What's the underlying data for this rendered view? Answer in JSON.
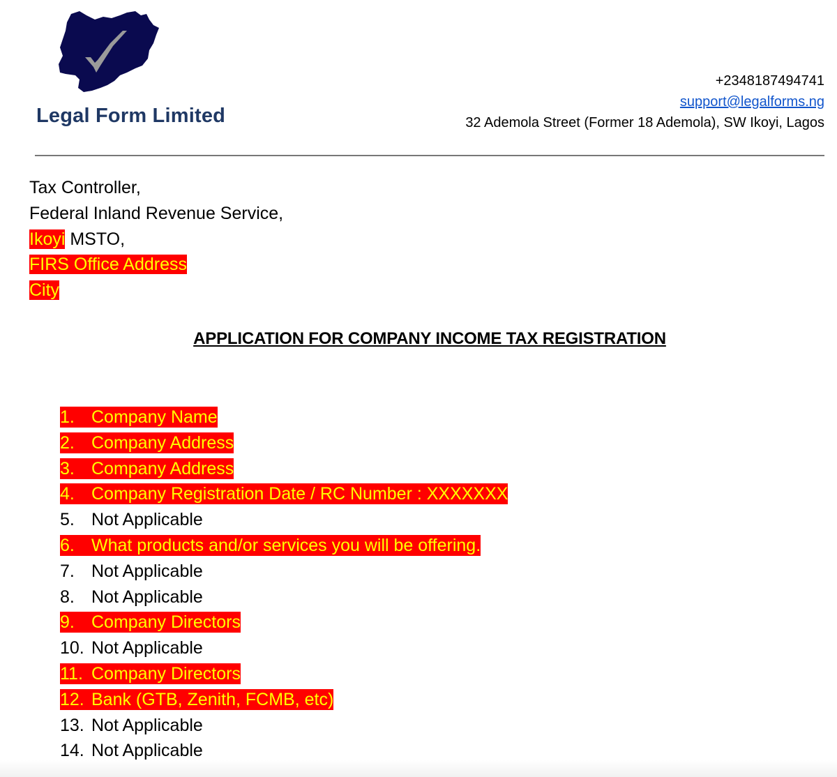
{
  "letterhead": {
    "logo_icon": "nigeria-map-checkmark-logo",
    "company_name": "Legal Form Limited",
    "phone": "+2348187494741",
    "email": "support@legalforms.ng",
    "address": "32 Ademola Street (Former 18 Ademola), SW Ikoyi, Lagos"
  },
  "recipient": {
    "line1": "Tax Controller,",
    "line2": "Federal Inland Revenue Service,",
    "line3_highlight": "Ikoyi",
    "line3_rest": " MSTO,",
    "line4": "FIRS Office Address",
    "line5": "City"
  },
  "title": "APPLICATION FOR COMPANY INCOME TAX REGISTRATION",
  "items": [
    {
      "num": "1.",
      "text": "Company Name",
      "highlighted": true
    },
    {
      "num": "2.",
      "text": "Company Address",
      "highlighted": true
    },
    {
      "num": "3.",
      "text": "Company Address",
      "highlighted": true
    },
    {
      "num": "4.",
      "text": "Company Registration Date / RC Number : XXXXXXX",
      "highlighted": true
    },
    {
      "num": "5.",
      "text": "Not Applicable",
      "highlighted": false
    },
    {
      "num": "6.",
      "text": "What products and/or services you will be offering.",
      "highlighted": true
    },
    {
      "num": "7.",
      "text": "Not Applicable",
      "highlighted": false
    },
    {
      "num": "8.",
      "text": "Not Applicable",
      "highlighted": false
    },
    {
      "num": "9.",
      "text": "Company Directors",
      "highlighted": true
    },
    {
      "num": "10.",
      "text": "Not Applicable",
      "highlighted": false
    },
    {
      "num": "11.",
      "text": "Company Directors",
      "highlighted": true
    },
    {
      "num": "12.",
      "text": "Bank (GTB, Zenith, FCMB, etc)",
      "highlighted": true
    },
    {
      "num": "13.",
      "text": "Not Applicable",
      "highlighted": false
    },
    {
      "num": "14.",
      "text": "Not Applicable",
      "highlighted": false
    }
  ],
  "colors": {
    "brand": "#1f3864",
    "logo_fill": "#0a0a4f",
    "checkmark": "#999999",
    "highlight_bg": "#ff0000",
    "highlight_text": "#ffff00",
    "link": "#1155cc"
  }
}
